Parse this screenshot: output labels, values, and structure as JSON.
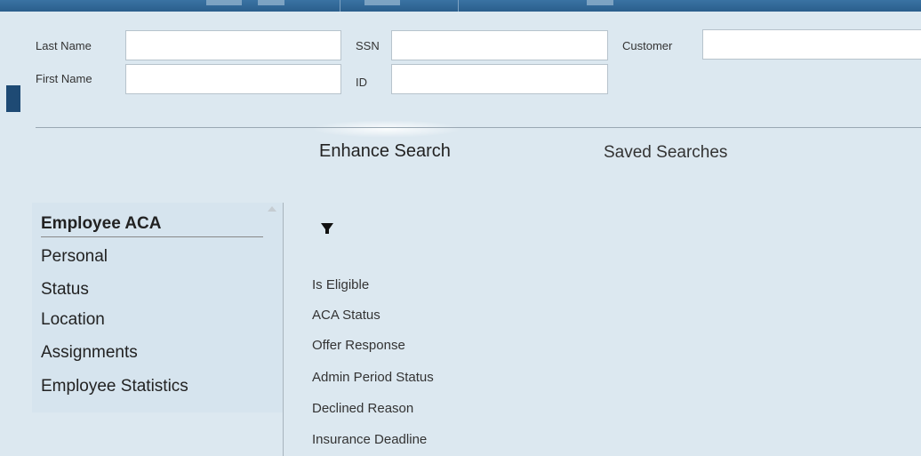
{
  "search_form": {
    "last_name_label": "Last Name",
    "first_name_label": "First Name",
    "ssn_label": "SSN",
    "id_label": "ID",
    "customer_label": "Customer",
    "last_name_value": "",
    "first_name_value": "",
    "ssn_value": "",
    "id_value": "",
    "customer_value": ""
  },
  "tabs": {
    "enhance_search": "Enhance Search",
    "saved_searches": "Saved Searches"
  },
  "categories": [
    "Employee ACA",
    "Personal",
    "Status",
    "Location",
    "Assignments",
    "Employee Statistics"
  ],
  "selected_category": "Employee ACA",
  "fields": [
    "Is Eligible",
    "ACA Status",
    "Offer Response",
    "Admin Period Status",
    "Declined Reason",
    "Insurance Deadline"
  ],
  "icons": {
    "filter": "filter-icon"
  },
  "colors": {
    "background": "#dce8f0",
    "topbar": "#2a5e8c"
  }
}
